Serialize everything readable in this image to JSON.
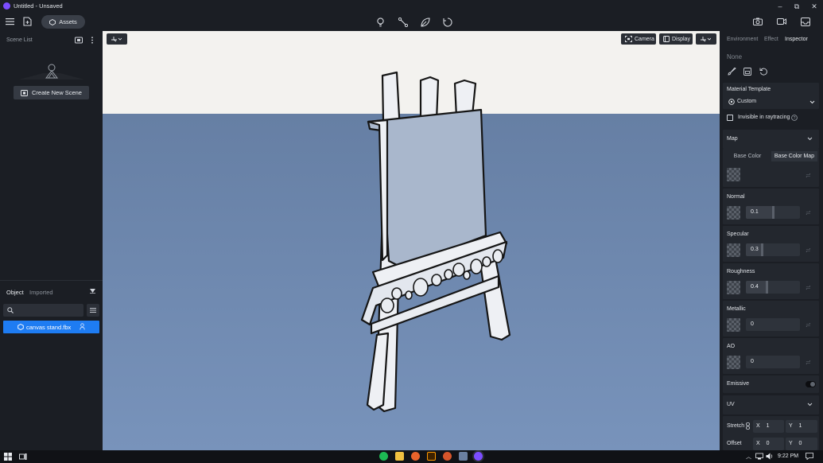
{
  "window": {
    "title": "Untitled - Unsaved",
    "minimize": "–",
    "maximize": "⧉",
    "close": "✕"
  },
  "toolbar": {
    "assets_label": "Assets"
  },
  "left_panel": {
    "scene_list_title": "Scene List",
    "create_scene_label": "Create New Scene",
    "tabs": [
      "Object",
      "Imported"
    ],
    "search_placeholder": "",
    "objects": [
      {
        "name": "canvas stand.fbx"
      }
    ]
  },
  "viewport": {
    "camera_label": "Camera",
    "display_label": "Display"
  },
  "inspector": {
    "tabs": [
      "Environment",
      "Effect",
      "Inspector"
    ],
    "selection": "None",
    "material_template_label": "Material Template",
    "material_template_value": "Custom",
    "invisible_raytracing_label": "Invisible in raytracing",
    "map": {
      "title": "Map",
      "tabs": [
        "Base Color",
        "Base Color Map"
      ]
    },
    "properties": [
      {
        "name": "Normal",
        "value": "0.1",
        "fill": 0.55
      },
      {
        "name": "Specular",
        "value": "0.3",
        "fill": 0.0
      },
      {
        "name": "Roughness",
        "value": "0.4",
        "fill": 0.0
      },
      {
        "name": "Metallic",
        "value": "0",
        "fill": 0.0
      },
      {
        "name": "AO",
        "value": "0",
        "fill": 0.0
      }
    ],
    "emissive_label": "Emissive",
    "uv": {
      "title": "UV",
      "stretch_label": "Stretch",
      "offset_label": "Offset",
      "stretch_x": "1",
      "stretch_y": "1",
      "offset_x": "0",
      "offset_y": "0",
      "x_label": "X",
      "y_label": "Y"
    }
  },
  "taskbar": {
    "time": "9:22 PM"
  },
  "colors": {
    "accent": "#1e7cf2",
    "brand": "#7b4dff",
    "viewport_ground": "#6a86ad",
    "viewport_sky": "#f2f1ee"
  }
}
